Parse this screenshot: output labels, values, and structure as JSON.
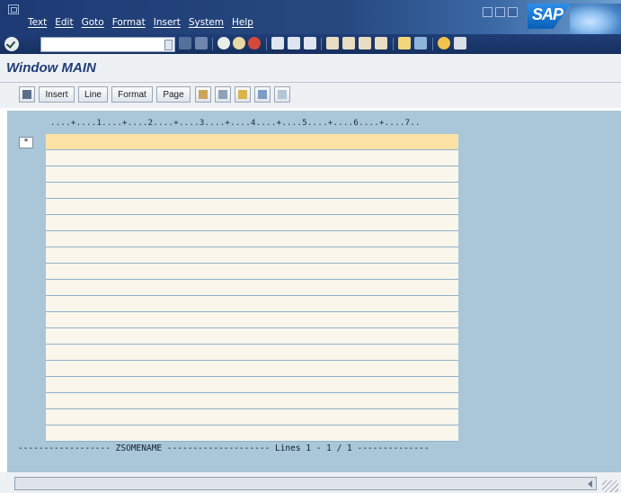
{
  "menu": {
    "items": [
      "Text",
      "Edit",
      "Goto",
      "Format",
      "Insert",
      "System",
      "Help"
    ]
  },
  "brand": {
    "logo_text": "SAP"
  },
  "command_field": {
    "value": ""
  },
  "screen": {
    "title": "Window MAIN"
  },
  "app_toolbar": {
    "buttons": [
      "Insert",
      "Line",
      "Format",
      "Page"
    ]
  },
  "editor": {
    "ruler": "....+....1....+....2....+....3....+....4....+....5....+....6....+....7..",
    "marker": "*",
    "line_count_visible": 19,
    "footer": "------------------ ZSOMENAME -------------------- Lines 1 - 1 / 1 --------------"
  },
  "colors": {
    "title_bar": "#1d3a74",
    "header_bg": "#eef1f4",
    "title_text": "#1f3d77",
    "editor_bg": "#a9c7d8",
    "line_bg": "#fbf6ec",
    "active_line_bg": "#fce3a5"
  }
}
